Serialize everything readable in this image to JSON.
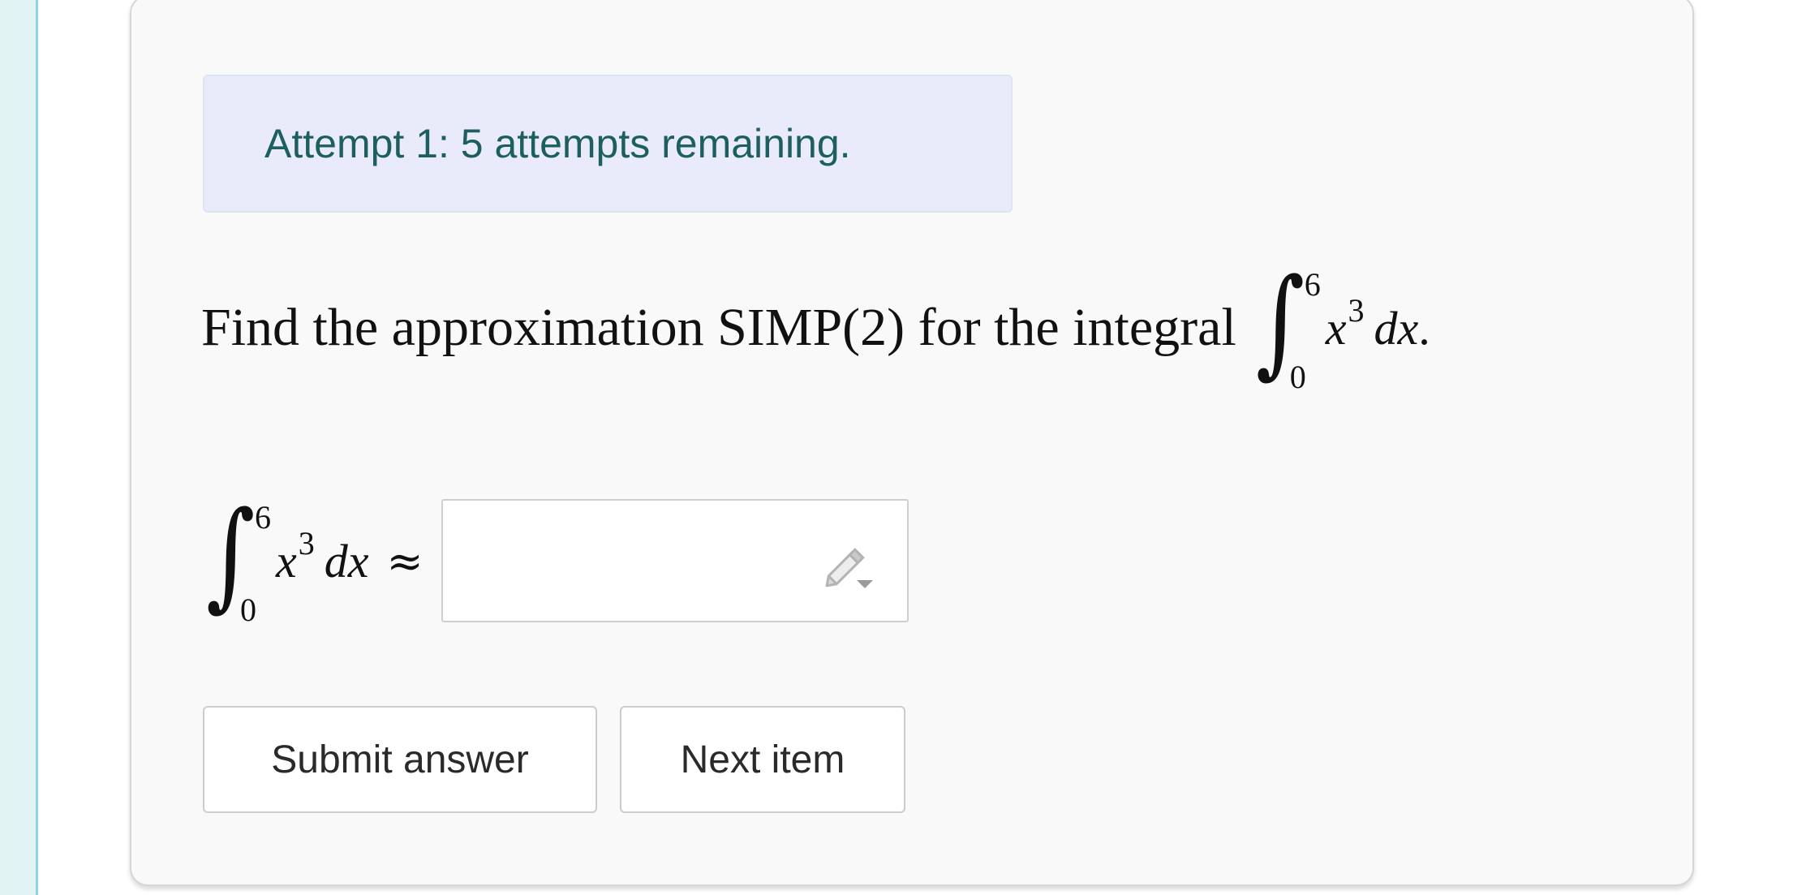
{
  "attempt_banner": {
    "text": "Attempt 1: 5 attempts remaining."
  },
  "question": {
    "prompt": "Find the approximation SIMP(2) for the integral",
    "integral": {
      "lower": "0",
      "upper": "6",
      "variable": "x",
      "exponent": "3",
      "differential": "dx"
    },
    "trailing_punctuation": "."
  },
  "answer": {
    "approx_symbol": "≈",
    "value": "",
    "placeholder": "",
    "edit_icon": "pencil-icon"
  },
  "buttons": {
    "submit_label": "Submit answer",
    "next_label": "Next item"
  },
  "colors": {
    "banner_background": "#e9ebfb",
    "banner_text": "#1d5e5f",
    "card_background": "#f9f9f9",
    "left_strip": "#e1f3f3",
    "left_strip_border": "#8fd3ea"
  }
}
